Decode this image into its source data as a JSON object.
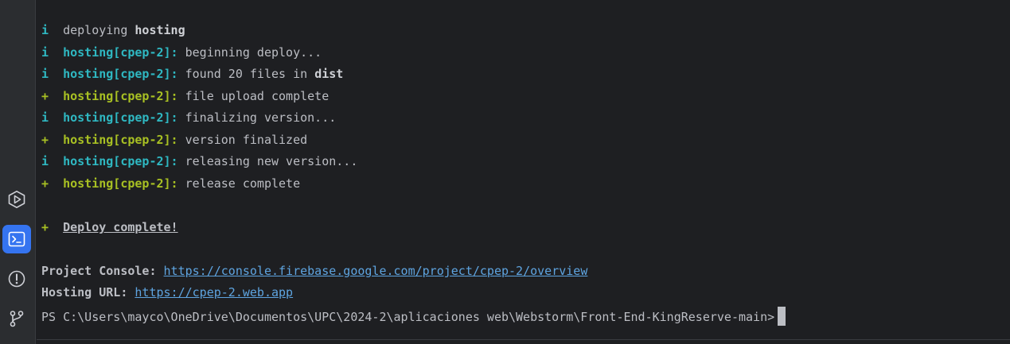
{
  "sidebar": {
    "tools": [
      {
        "name": "run-tool",
        "icon": "run-icon",
        "active": false
      },
      {
        "name": "terminal-tool",
        "icon": "terminal-icon",
        "active": true
      },
      {
        "name": "problems-tool",
        "icon": "problems-icon",
        "active": false
      },
      {
        "name": "git-tool",
        "icon": "git-branch-icon",
        "active": false
      }
    ]
  },
  "terminal": {
    "lines": [
      {
        "marker": "i",
        "prefix": "",
        "text": "deploying ",
        "bold": "hosting"
      },
      {
        "marker": "i",
        "prefix": "hosting[cpep-2]:",
        "text": "beginning deploy..."
      },
      {
        "marker": "i",
        "prefix": "hosting[cpep-2]:",
        "text": "found 20 files in ",
        "bold": "dist"
      },
      {
        "marker": "+",
        "prefix": "hosting[cpep-2]:",
        "text": "file upload complete"
      },
      {
        "marker": "i",
        "prefix": "hosting[cpep-2]:",
        "text": "finalizing version..."
      },
      {
        "marker": "+",
        "prefix": "hosting[cpep-2]:",
        "text": "version finalized"
      },
      {
        "marker": "i",
        "prefix": "hosting[cpep-2]:",
        "text": "releasing new version..."
      },
      {
        "marker": "+",
        "prefix": "hosting[cpep-2]:",
        "text": "release complete"
      }
    ],
    "deploy_marker": "+",
    "deploy_complete": "Deploy complete!",
    "project_console_label": "Project Console:",
    "project_console_url": "https://console.firebase.google.com/project/cpep-2/overview",
    "hosting_url_label": "Hosting URL:",
    "hosting_url": "https://cpep-2.web.app",
    "prompt": "PS C:\\Users\\mayco\\OneDrive\\Documentos\\UPC\\2024-2\\aplicaciones web\\Webstorm\\Front-End-KingReserve-main>"
  },
  "colors": {
    "background": "#1e1f22",
    "sidebar": "#2b2d30",
    "info": "#2fb8c2",
    "success": "#a8c023",
    "link": "#5ea4e0",
    "active_tool": "#3574f0"
  }
}
